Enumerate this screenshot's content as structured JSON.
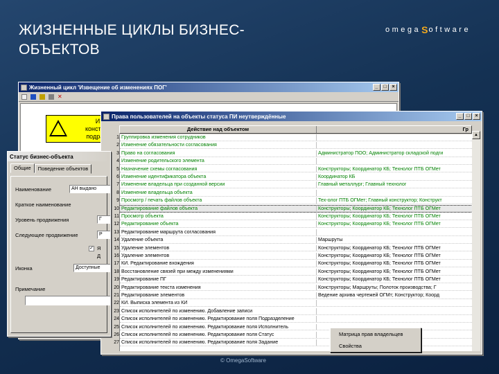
{
  "slide": {
    "title": "ЖИЗНЕННЫЕ ЦИКЛЫ БИЗНЕС-ОБЪЕКТОВ",
    "logo_left": "omega",
    "logo_right": "oftware",
    "footer": "© OmegaSoftware"
  },
  "colors": {
    "background": "#143153",
    "titlebar": "#0a246a",
    "green_text": "#008000",
    "blue_text": "#0000c0",
    "logo_accent": "#f2a81d"
  },
  "window_lifecycle": {
    "title": "Жизненный цикл 'Извещение об изменениях ПОГ'",
    "node_label": "И\nконструк\nподразу"
  },
  "window_properties": {
    "title": "Статус бизнес-объекта",
    "tabs": [
      "Общие",
      "Поведение объектов"
    ],
    "fields": [
      {
        "label": "Наименование",
        "value": "АН выдано"
      },
      {
        "label": "Краткое наименование",
        "value": ""
      },
      {
        "label": "Уровень продвижения",
        "value": "Г"
      },
      {
        "label": "Следующее продвижение",
        "value": "Р"
      },
      {
        "label": "Иконка",
        "value": "Доступные"
      },
      {
        "label": "Примечание",
        "value": ""
      }
    ],
    "checkbox_label": "Я",
    "checkbox_label2": "Д"
  },
  "window_rights": {
    "title": "Права пользователей на объекты статуса ПИ неутверждённые",
    "col_action": "Действие над объектом",
    "col_roles": "Гр",
    "rows": [
      {
        "n": "1",
        "action": "Группировка изменения сотрудников",
        "roles": "",
        "color": "green"
      },
      {
        "n": "2",
        "action": "Изменение обязательности согласования",
        "roles": "",
        "color": "green"
      },
      {
        "n": "3",
        "action": "Право на согласования",
        "roles": "Администратор ПОО; Администратор складской подги",
        "color": "green"
      },
      {
        "n": "4",
        "action": "Изменение родительского элемента",
        "roles": "",
        "color": "green"
      },
      {
        "n": "5",
        "action": "Назначение схемы согласования",
        "roles": "Конструкторы; Координатор КБ; Технолог ПТБ ОГМет",
        "color": "green"
      },
      {
        "n": "6",
        "action": "Изменение идентификатора объекта",
        "roles": "Координатор КБ",
        "color": "green"
      },
      {
        "n": "7",
        "action": "Изменение владельца при созданной версии",
        "roles": "Главный металлург; Главный технолог",
        "color": "green"
      },
      {
        "n": "8",
        "action": "Изменение владельца объекта",
        "roles": "",
        "color": "green"
      },
      {
        "n": "9",
        "action": "Просмотр / печать файлов объекта",
        "roles": "Тех-олог ПТБ ОГМет; Главный конструктор; Конструкт",
        "color": "green"
      },
      {
        "n": "10",
        "action": "Редактирование файлов объекта",
        "roles": "Конструкторы; Координатор КБ; Технолог ПТБ ОГМет",
        "color": "green"
      },
      {
        "n": "11",
        "action": "Просмотр объекта",
        "roles": "Конструкторы; Координатор КБ; Технолог ПТБ ОГМет",
        "color": "green"
      },
      {
        "n": "12",
        "action": "Редактирование объекта",
        "roles": "Конструкторы; Координатор КБ; Технолог ПТБ ОГМет",
        "color": "green"
      },
      {
        "n": "13",
        "action": "Редактирование маршрута согласования",
        "roles": "",
        "color": "black"
      },
      {
        "n": "14",
        "action": "Удаление объекта",
        "roles": "Маршруты",
        "color": "black"
      },
      {
        "n": "15",
        "action": "Удаление элементов",
        "roles": "Конструкторы; Координатор КБ; Технолог ПТБ ОГМет",
        "color": "black"
      },
      {
        "n": "16",
        "action": "Удаление элементов",
        "roles": "Конструкторы; Координатор КБ; Технолог ПТБ ОГМет",
        "color": "black"
      },
      {
        "n": "17",
        "action": "КИ. Редактирование вхождения",
        "roles": "Конструкторы; Координатор КБ; Технолог ПТБ ОГМет",
        "color": "black"
      },
      {
        "n": "18",
        "action": "Восстановление связей при между изменениями",
        "roles": "Конструкторы; Координатор КБ; Технолог ПТБ ОГМет",
        "color": "black"
      },
      {
        "n": "19",
        "action": "Редактирование ПГ",
        "roles": "Конструкторы; Координатор КБ; Технолог ПТБ ОГМет",
        "color": "black"
      },
      {
        "n": "20",
        "action": "Редактирование текста изменения",
        "roles": "Конструкторы; Маршруты; Полоток производства; Г",
        "color": "black"
      },
      {
        "n": "21",
        "action": "Редактирование элементов",
        "roles": "Ведение архива чертежей ОГМт; Конструктор; Коорд",
        "color": "black"
      },
      {
        "n": "22",
        "action": "КИ. Выписка элемента из КИ",
        "roles": "",
        "color": "black"
      },
      {
        "n": "23",
        "action": "Список исполнителей по изменению. Добавление записи",
        "roles": "",
        "color": "black"
      },
      {
        "n": "24",
        "action": "Список исполнителей по изменению. Редактирование поля Подразделение",
        "roles": "",
        "color": "black"
      },
      {
        "n": "25",
        "action": "Список исполнителей по изменению. Редактирование поля Исполнитель",
        "roles": "",
        "color": "black"
      },
      {
        "n": "26",
        "action": "Список исполнителей по изменению. Редактирование поля Статус",
        "roles": "",
        "color": "black"
      },
      {
        "n": "27",
        "action": "Список исполнителей по изменению. Редактирование поля Задание",
        "roles": "",
        "color": "black"
      }
    ],
    "context_menu": [
      "Матрица прав владельцев",
      "Свойства"
    ]
  }
}
